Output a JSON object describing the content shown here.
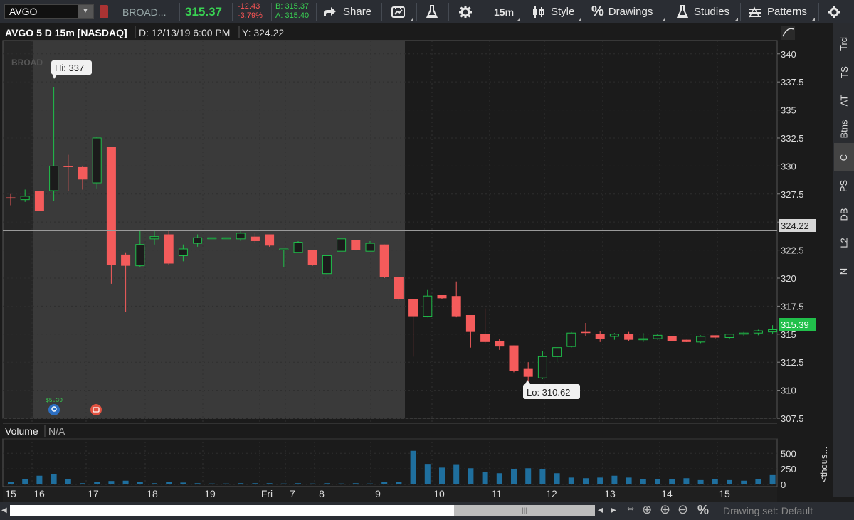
{
  "toolbar": {
    "symbol": "AVGO",
    "company": "BROAD...",
    "last_price": "315.37",
    "net_change": "-12.43",
    "pct_change": "-3.79%",
    "bid": "B: 315.37",
    "ask": "A: 315.40",
    "share_label": "Share",
    "timeframe": "15m",
    "style_label": "Style",
    "drawings_label": "Drawings",
    "studies_label": "Studies",
    "patterns_label": "Patterns"
  },
  "chart_header": {
    "title": "AVGO 5 D 15m [NASDAQ]",
    "date_readout": "D: 12/13/19 6:00 PM",
    "y_readout": "Y: 324.22"
  },
  "watermark": "BROAD",
  "markers": {
    "high": "Hi: 337",
    "low": "Lo: 310.62",
    "dividend": "$5.39"
  },
  "price_tags": {
    "cursor": "324.22",
    "last": "315.39"
  },
  "volume_panel": {
    "label": "Volume",
    "value": "N/A",
    "unit_label": "<thous..."
  },
  "right_rail": [
    "Trd",
    "TS",
    "AT",
    "Btns",
    "C",
    "PS",
    "DB",
    "L2",
    "N"
  ],
  "right_rail_active": "C",
  "bottom_bar": {
    "drawing_set": "Drawing set: Default"
  },
  "colors": {
    "up": "#1fbf4a",
    "down": "#f45b5b",
    "accent_blue": "#1f6f9e",
    "last_price_green": "#39d353",
    "negative_red": "#ff5555"
  },
  "chart_data": {
    "type": "candlestick",
    "price_ylim": [
      307.5,
      341
    ],
    "price_ticks": [
      "340",
      "337.5",
      "335",
      "332.5",
      "330",
      "327.5",
      "325",
      "322.5",
      "320",
      "317.5",
      "315",
      "312.5",
      "310",
      "307.5"
    ],
    "volume_ticks": [
      "500",
      "250",
      "0"
    ],
    "volume_ylim": [
      0,
      640
    ],
    "x_tick_labels": [
      "15",
      "16",
      "17",
      "18",
      "19",
      "Fri",
      "7",
      "8",
      "9",
      "10",
      "11",
      "12",
      "13",
      "14",
      "15"
    ],
    "cursor_price": 324.22,
    "candles": [
      {
        "o": 327.2,
        "h": 327.5,
        "l": 326.5,
        "c": 327.1
      },
      {
        "o": 327.0,
        "h": 327.9,
        "l": 326.8,
        "c": 327.3
      },
      {
        "o": 327.8,
        "h": 327.8,
        "l": 326.0,
        "c": 326.0
      },
      {
        "o": 327.8,
        "h": 337.0,
        "l": 326.9,
        "c": 330.0
      },
      {
        "o": 330.0,
        "h": 331.0,
        "l": 327.8,
        "c": 329.9
      },
      {
        "o": 329.9,
        "h": 330.0,
        "l": 327.9,
        "c": 328.8
      },
      {
        "o": 328.5,
        "h": 332.6,
        "l": 328.0,
        "c": 332.5
      },
      {
        "o": 331.7,
        "h": 331.7,
        "l": 319.5,
        "c": 321.2
      },
      {
        "o": 322.1,
        "h": 322.3,
        "l": 317.0,
        "c": 321.1
      },
      {
        "o": 321.1,
        "h": 324.2,
        "l": 321.0,
        "c": 323.0
      },
      {
        "o": 323.5,
        "h": 324.2,
        "l": 323.0,
        "c": 323.7
      },
      {
        "o": 323.9,
        "h": 324.2,
        "l": 321.2,
        "c": 321.3
      },
      {
        "o": 322.0,
        "h": 323.0,
        "l": 321.5,
        "c": 322.6
      },
      {
        "o": 323.1,
        "h": 323.9,
        "l": 322.8,
        "c": 323.6
      },
      {
        "o": 323.6,
        "h": 323.6,
        "l": 323.5,
        "c": 323.6
      },
      {
        "o": 323.6,
        "h": 323.6,
        "l": 323.5,
        "c": 323.6
      },
      {
        "o": 323.5,
        "h": 324.2,
        "l": 323.3,
        "c": 324.0
      },
      {
        "o": 323.7,
        "h": 324.0,
        "l": 323.1,
        "c": 323.3
      },
      {
        "o": 323.9,
        "h": 323.9,
        "l": 322.8,
        "c": 322.9
      },
      {
        "o": 322.6,
        "h": 322.6,
        "l": 321.0,
        "c": 322.6
      },
      {
        "o": 322.3,
        "h": 323.3,
        "l": 322.3,
        "c": 323.2
      },
      {
        "o": 322.5,
        "h": 322.5,
        "l": 321.1,
        "c": 321.2
      },
      {
        "o": 320.4,
        "h": 322.0,
        "l": 320.3,
        "c": 322.0
      },
      {
        "o": 322.4,
        "h": 323.5,
        "l": 322.4,
        "c": 323.5
      },
      {
        "o": 323.4,
        "h": 323.4,
        "l": 322.5,
        "c": 322.5
      },
      {
        "o": 322.4,
        "h": 323.3,
        "l": 322.4,
        "c": 323.1
      },
      {
        "o": 323.0,
        "h": 323.0,
        "l": 320.0,
        "c": 320.1
      },
      {
        "o": 320.1,
        "h": 320.1,
        "l": 318.0,
        "c": 318.1
      },
      {
        "o": 318.1,
        "h": 318.1,
        "l": 313.0,
        "c": 316.6
      },
      {
        "o": 316.6,
        "h": 319.0,
        "l": 316.5,
        "c": 318.4
      },
      {
        "o": 318.5,
        "h": 318.5,
        "l": 318.1,
        "c": 318.2
      },
      {
        "o": 318.4,
        "h": 319.7,
        "l": 316.5,
        "c": 316.6
      },
      {
        "o": 316.7,
        "h": 316.7,
        "l": 313.8,
        "c": 315.2
      },
      {
        "o": 315.0,
        "h": 317.3,
        "l": 314.2,
        "c": 314.3
      },
      {
        "o": 314.4,
        "h": 314.6,
        "l": 313.6,
        "c": 313.9
      },
      {
        "o": 314.0,
        "h": 314.0,
        "l": 311.6,
        "c": 311.7
      },
      {
        "o": 311.9,
        "h": 312.5,
        "l": 310.6,
        "c": 311.2
      },
      {
        "o": 311.1,
        "h": 313.5,
        "l": 311.0,
        "c": 313.0
      },
      {
        "o": 313.0,
        "h": 313.8,
        "l": 312.5,
        "c": 313.8
      },
      {
        "o": 313.9,
        "h": 315.2,
        "l": 313.8,
        "c": 315.1
      },
      {
        "o": 315.2,
        "h": 316.0,
        "l": 314.8,
        "c": 315.1
      },
      {
        "o": 315.0,
        "h": 315.3,
        "l": 314.3,
        "c": 314.6
      },
      {
        "o": 314.8,
        "h": 315.1,
        "l": 314.5,
        "c": 315.0
      },
      {
        "o": 315.0,
        "h": 315.2,
        "l": 314.4,
        "c": 314.5
      },
      {
        "o": 314.5,
        "h": 315.1,
        "l": 314.3,
        "c": 314.6
      },
      {
        "o": 314.6,
        "h": 315.0,
        "l": 314.5,
        "c": 314.9
      },
      {
        "o": 314.8,
        "h": 314.8,
        "l": 314.4,
        "c": 314.4
      },
      {
        "o": 314.5,
        "h": 314.5,
        "l": 314.3,
        "c": 314.3
      },
      {
        "o": 314.3,
        "h": 314.9,
        "l": 314.2,
        "c": 314.8
      },
      {
        "o": 314.9,
        "h": 314.9,
        "l": 314.6,
        "c": 314.7
      },
      {
        "o": 314.7,
        "h": 315.0,
        "l": 314.6,
        "c": 315.0
      },
      {
        "o": 315.0,
        "h": 315.2,
        "l": 314.8,
        "c": 315.1
      },
      {
        "o": 315.1,
        "h": 315.4,
        "l": 314.9,
        "c": 315.3
      },
      {
        "o": 315.2,
        "h": 315.8,
        "l": 315.0,
        "c": 315.4
      }
    ],
    "volumes": [
      40,
      80,
      140,
      165,
      90,
      20,
      40,
      55,
      60,
      35,
      20,
      40,
      30,
      20,
      15,
      15,
      20,
      20,
      20,
      15,
      20,
      15,
      20,
      15,
      20,
      15,
      40,
      40,
      540,
      330,
      270,
      325,
      260,
      200,
      180,
      250,
      260,
      250,
      180,
      110,
      100,
      110,
      140,
      110,
      90,
      80,
      80,
      100,
      70,
      90,
      70,
      60,
      80,
      150
    ]
  }
}
